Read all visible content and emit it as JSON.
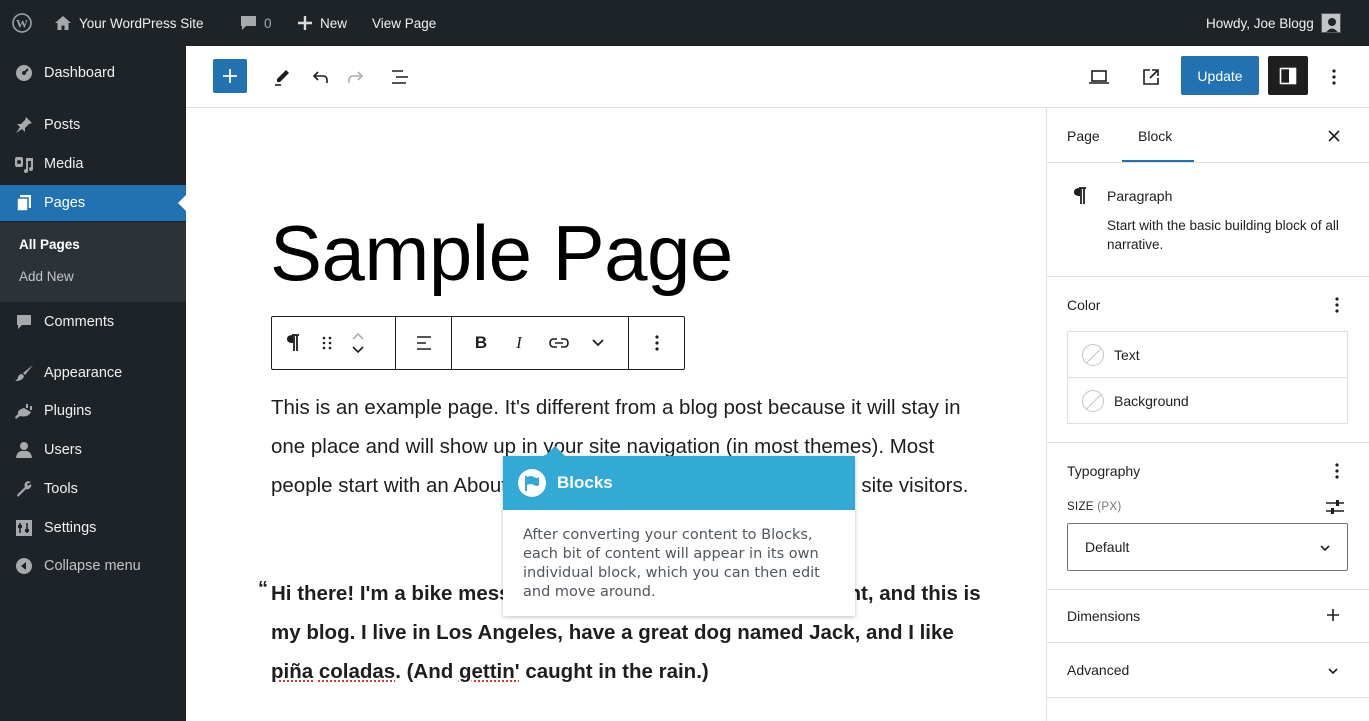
{
  "admin_bar": {
    "site_name": "Your WordPress Site",
    "comments_count": "0",
    "new_label": "New",
    "view_page_label": "View Page",
    "greeting": "Howdy, Joe Blogg"
  },
  "sidebar": {
    "items": [
      {
        "label": "Dashboard",
        "icon": "dashboard-icon"
      },
      {
        "label": "Posts",
        "icon": "pin-icon"
      },
      {
        "label": "Media",
        "icon": "media-icon"
      },
      {
        "label": "Pages",
        "icon": "pages-icon"
      },
      {
        "label": "Comments",
        "icon": "comments-icon"
      },
      {
        "label": "Appearance",
        "icon": "brush-icon"
      },
      {
        "label": "Plugins",
        "icon": "plugin-icon"
      },
      {
        "label": "Users",
        "icon": "users-icon"
      },
      {
        "label": "Tools",
        "icon": "wrench-icon"
      },
      {
        "label": "Settings",
        "icon": "settings-icon"
      },
      {
        "label": "Collapse menu",
        "icon": "collapse-icon"
      }
    ],
    "current": "Pages",
    "submenu": [
      "All Pages",
      "Add New"
    ]
  },
  "toolbar": {
    "update_label": "Update"
  },
  "editor": {
    "title": "Sample Page",
    "paragraph": "This is an example page. It's different from a blog post because it will stay in one place and will show up in your site navigation (in most themes). Most people start with an About page that introduces them to potential site visitors.",
    "quote_before": "Hi there! I'm a bike messenger by day, aspiring actor by night, and this is my blog. I live in Los Angeles, have a great dog named Jack, and I like ",
    "quote_sq1": "piña",
    "quote_sq2": "coladas",
    "quote_mid": ". (And ",
    "quote_sq3": "gettin'",
    "quote_after": " caught in the rain.)",
    "quote_mark": "“"
  },
  "tooltip": {
    "title": "Blocks",
    "body": "After converting your content to Blocks, each bit of content will appear in its own individual block, which you can then edit and move around.",
    "accent": "#33aad6"
  },
  "settings_panel": {
    "tabs": [
      "Page",
      "Block"
    ],
    "active_tab": "Block",
    "block_name": "Paragraph",
    "block_description": "Start with the basic building block of all narrative.",
    "color_heading": "Color",
    "color_options": [
      "Text",
      "Background"
    ],
    "typography_heading": "Typography",
    "size_label": "SIZE",
    "size_unit": "(PX)",
    "size_value": "Default",
    "dimensions_heading": "Dimensions",
    "advanced_heading": "Advanced"
  },
  "colors": {
    "admin_dark": "#1d2327",
    "primary_blue": "#2271b1"
  }
}
